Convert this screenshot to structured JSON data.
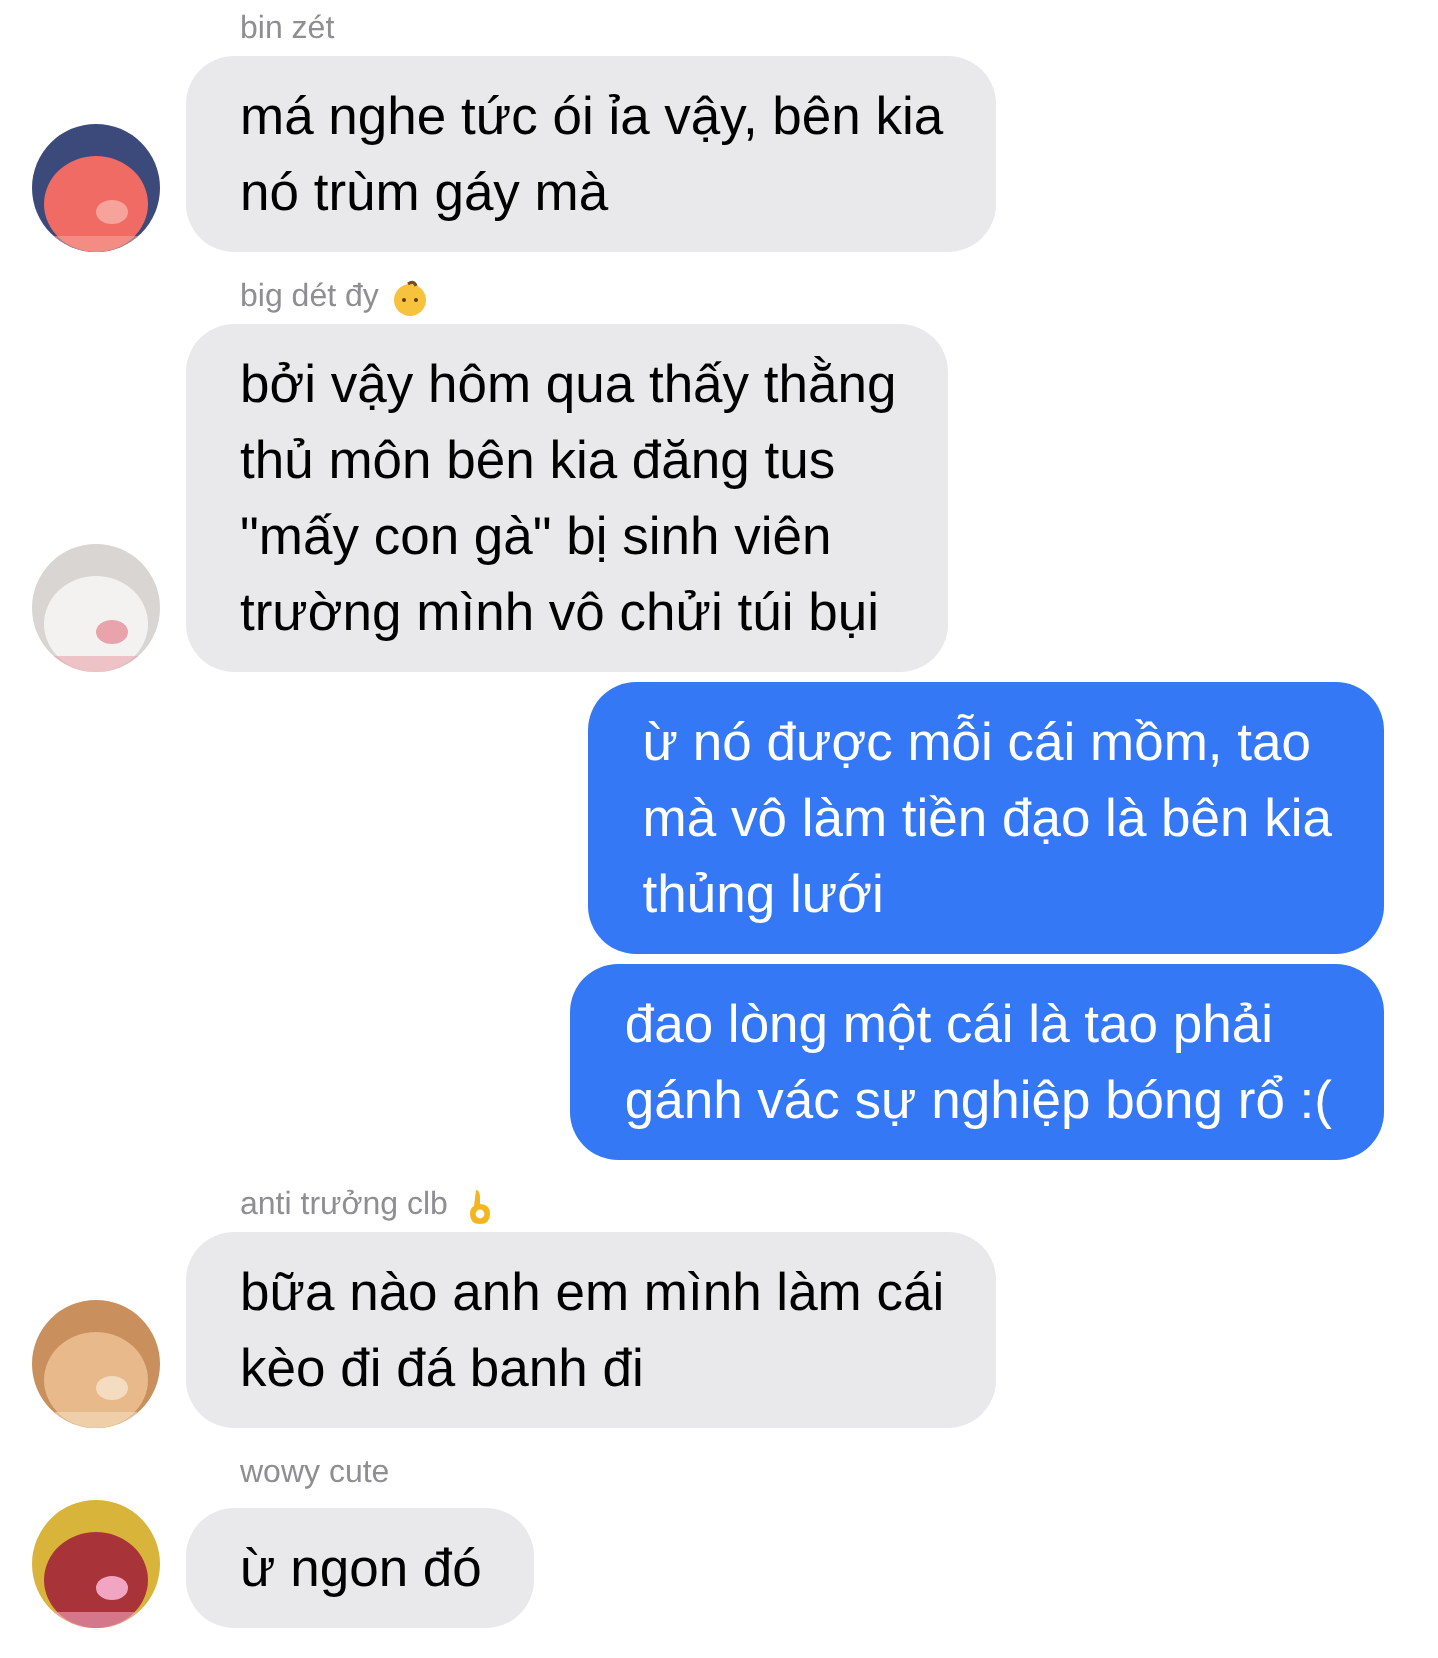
{
  "messages": [
    {
      "kind": "incoming",
      "sender": "bin zét",
      "text": "má nghe tức ói ỉa vậy, bên kia\nnó trùm gáy mà"
    },
    {
      "kind": "incoming",
      "sender": "big dét đy",
      "badge": {
        "kind": "baby"
      },
      "text": "bởi vậy hôm qua thấy thằng\nthủ môn bên kia đăng tus\n\"mấy con gà\" bị sinh viên\ntrường mình vô chửi túi bụi"
    },
    {
      "kind": "outgoing",
      "text": "ừ nó được mỗi cái mồm, tao\nmà vô làm tiền đạo là bên kia\nthủng lưới"
    },
    {
      "kind": "outgoing",
      "text": "đao lòng một cái là tao phải\ngánh vác sự nghiệp bóng rổ :("
    },
    {
      "kind": "incoming",
      "sender": "anti trưởng clb",
      "badge": {
        "kind": "ok"
      },
      "text": "bữa nào anh em mình làm cái\nkèo đi đá banh đi"
    },
    {
      "kind": "incoming",
      "sender": "wowy cute",
      "text": "ừ ngon đó"
    }
  ]
}
